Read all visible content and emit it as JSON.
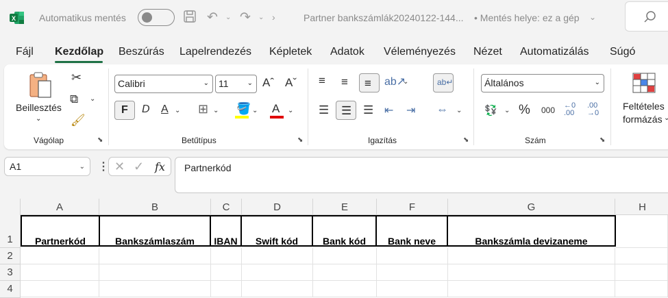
{
  "titlebar": {
    "autosave_label": "Automatikus mentés",
    "doc_title": "Partner bankszámlák20240122-144...",
    "save_location": "• Mentés helye: ez a gép"
  },
  "tabs": [
    "Fájl",
    "Kezdőlap",
    "Beszúrás",
    "Lapelrendezés",
    "Képletek",
    "Adatok",
    "Véleményezés",
    "Nézet",
    "Automatizálás",
    "Súgó"
  ],
  "ribbon": {
    "clipboard": {
      "paste_label": "Beillesztés",
      "group_label": "Vágólap"
    },
    "font": {
      "font_name": "Calibri",
      "font_size": "11",
      "bold": "F",
      "italic": "D",
      "underline": "A",
      "fill_color": "#ffff00",
      "font_color": "#e00000",
      "group_label": "Betűtípus"
    },
    "alignment": {
      "group_label": "Igazítás"
    },
    "number": {
      "format": "Általános",
      "percent": "%",
      "thousands": "000",
      "group_label": "Szám"
    },
    "styles": {
      "conditional_line1": "Feltételes",
      "conditional_line2": "formázás"
    }
  },
  "formula_bar": {
    "name_box": "A1",
    "fx": "fx",
    "formula": "Partnerkód"
  },
  "sheet": {
    "columns": [
      "A",
      "B",
      "C",
      "D",
      "E",
      "F",
      "G",
      "H"
    ],
    "rows": [
      "1",
      "2",
      "3",
      "4"
    ],
    "header_row": [
      "Partnerkód",
      "Bankszámlaszám",
      "IBAN",
      "Swift kód",
      "Bank kód",
      "Bank neve",
      "Bankszámla devizaneme"
    ]
  },
  "colors": {
    "accent": "#1e7145"
  }
}
